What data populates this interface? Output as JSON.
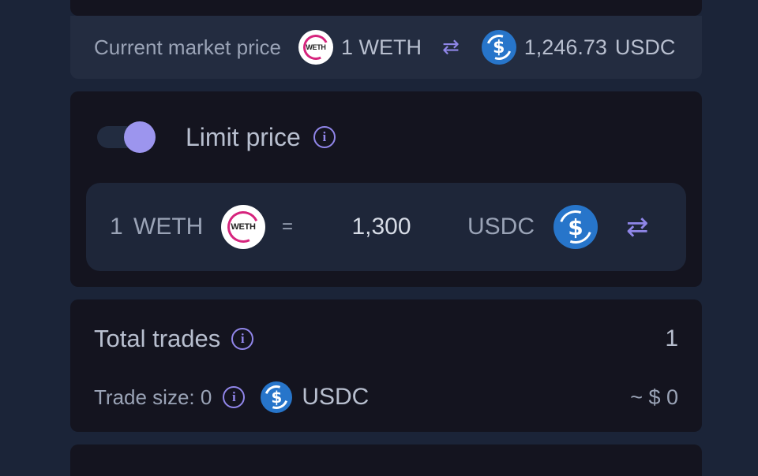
{
  "market": {
    "label": "Current market price",
    "base_amount": "1 WETH",
    "quote_amount": "1,246.73",
    "quote_unit": "USDC",
    "swap_glyph": "⇄",
    "weth_icon_text": "WETH",
    "usdc_icon_symbol": "$"
  },
  "limit": {
    "title": "Limit price",
    "enabled": true,
    "quantity": "1",
    "base_token": "WETH",
    "equals": "=",
    "price_value": "1,300",
    "quote_token": "USDC",
    "swap_glyph": "⇄",
    "info_glyph": "i"
  },
  "trades": {
    "total_label": "Total trades",
    "total_value": "1",
    "size_label": "Trade size: 0",
    "size_currency": "USDC",
    "usd_value": "~ $ 0",
    "info_glyph": "i"
  },
  "colors": {
    "page_bg": "#1b2438",
    "card_bg": "#14141f",
    "accent": "#9186ea",
    "usdc_blue": "#2775ca",
    "weth_pink": "#d6247d"
  },
  "icons": [
    "weth-token-icon",
    "usdc-token-icon",
    "swap-arrows-icon",
    "info-icon",
    "toggle-switch"
  ]
}
